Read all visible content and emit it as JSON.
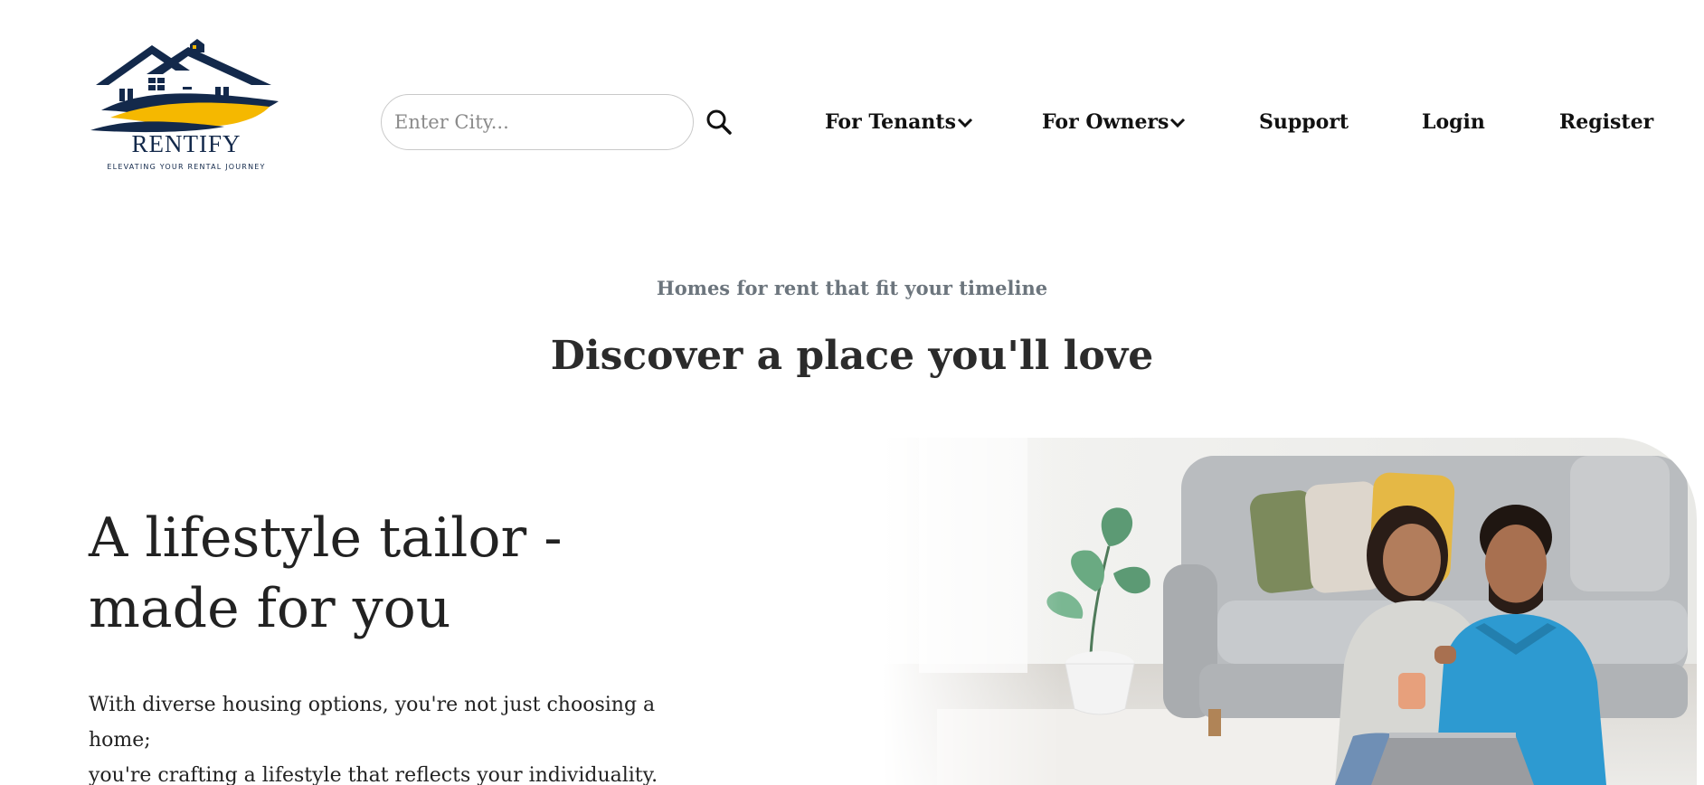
{
  "header": {
    "logo": {
      "name": "RENTIFY",
      "tagline": "ELEVATING YOUR RENTAL JOURNEY",
      "colors": {
        "navy": "#13294b",
        "gold": "#f5b800"
      }
    },
    "search": {
      "placeholder": "Enter City...",
      "value": "",
      "icon": "search-icon"
    },
    "nav": {
      "tenants": "For Tenants",
      "owners": "For Owners",
      "support": "Support",
      "login": "Login",
      "register": "Register",
      "dropdown_icon": "chevron-down-icon"
    }
  },
  "hero": {
    "eyebrow": "Homes for rent that fit your timeline",
    "heading": "Discover a place you'll love"
  },
  "lifestyle": {
    "title_line1": "A lifestyle tailor -",
    "title_line2": "made for you",
    "desc_line1": "With diverse housing options, you're not just choosing a",
    "desc_line2": "home;",
    "desc_line3": "you're crafting a lifestyle that reflects your individuality."
  },
  "photo": {
    "subject": "couple-on-sofa-with-laptop-image"
  }
}
